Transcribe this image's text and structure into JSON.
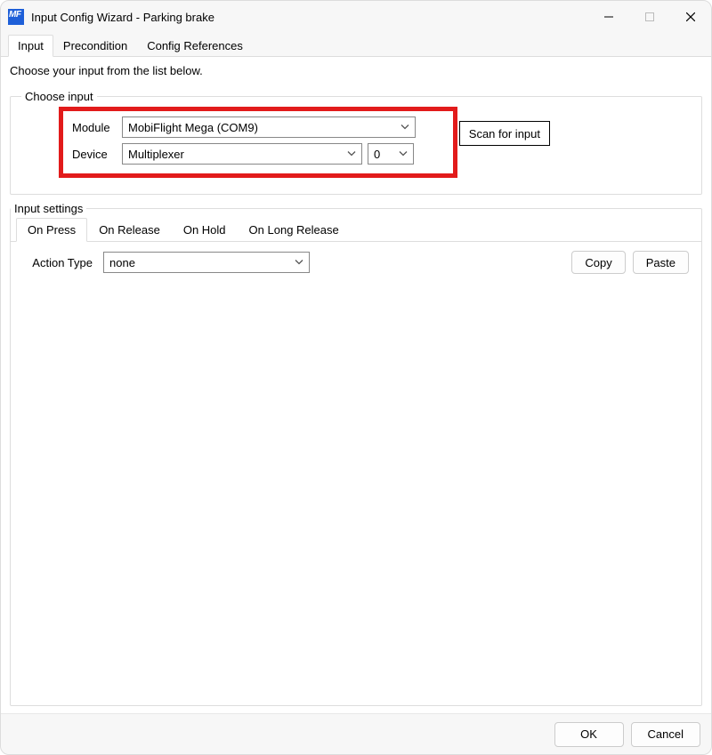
{
  "window": {
    "title": "Input Config Wizard - Parking brake"
  },
  "main_tabs": {
    "input": "Input",
    "precondition": "Precondition",
    "config_references": "Config References"
  },
  "instruction": "Choose your input from the list below.",
  "choose_input": {
    "legend": "Choose input",
    "module_label": "Module",
    "module_value": "MobiFlight Mega (COM9)",
    "device_label": "Device",
    "device_value": "Multiplexer",
    "pin_value": "0",
    "scan_label": "Scan for input"
  },
  "input_settings": {
    "legend": "Input settings",
    "tabs": {
      "on_press": "On Press",
      "on_release": "On Release",
      "on_hold": "On Hold",
      "on_long_release": "On Long Release"
    },
    "action_type_label": "Action Type",
    "action_type_value": "none",
    "copy_label": "Copy",
    "paste_label": "Paste"
  },
  "footer": {
    "ok": "OK",
    "cancel": "Cancel"
  }
}
